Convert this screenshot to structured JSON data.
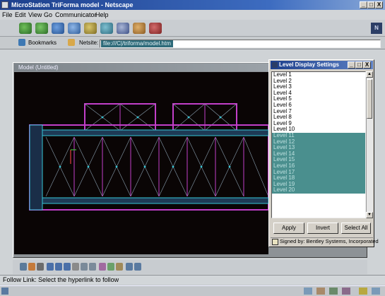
{
  "window": {
    "title": "MicroStation TriForma model - Netscape",
    "controls": [
      "_",
      "□",
      "X"
    ]
  },
  "menu": [
    "File",
    "Edit",
    "View",
    "Go",
    "Communicator",
    "Help"
  ],
  "toolbar_icons": [
    "back-icon",
    "forward-icon",
    "reload-icon",
    "home-icon",
    "search-icon",
    "netscape-icon",
    "print-icon",
    "security-icon",
    "stop-icon"
  ],
  "location": {
    "bookmarks_label": "Bookmarks",
    "netsite_label": "Netsite:",
    "url": "file:///C|/triforma/model.htm"
  },
  "model_window": {
    "title": "Model (Untitled)"
  },
  "level_dialog": {
    "title": "Level Display Settings",
    "levels": [
      {
        "label": "Level 1",
        "selected": false
      },
      {
        "label": "Level 2",
        "selected": false
      },
      {
        "label": "Level 3",
        "selected": false
      },
      {
        "label": "Level 4",
        "selected": false
      },
      {
        "label": "Level 5",
        "selected": false
      },
      {
        "label": "Level 6",
        "selected": false
      },
      {
        "label": "Level 7",
        "selected": false
      },
      {
        "label": "Level 8",
        "selected": false
      },
      {
        "label": "Level 9",
        "selected": false
      },
      {
        "label": "Level 10",
        "selected": false
      },
      {
        "label": "Level 11",
        "selected": true
      },
      {
        "label": "Level 12",
        "selected": true
      },
      {
        "label": "Level 13",
        "selected": true
      },
      {
        "label": "Level 14",
        "selected": true
      },
      {
        "label": "Level 15",
        "selected": true
      },
      {
        "label": "Level 16",
        "selected": true
      },
      {
        "label": "Level 17",
        "selected": true
      },
      {
        "label": "Level 18",
        "selected": true
      },
      {
        "label": "Level 19",
        "selected": true
      },
      {
        "label": "Level 20",
        "selected": true
      }
    ],
    "apply_label": "Apply",
    "invert_label": "Invert",
    "select_all_label": "Select All",
    "signed_text": "Signed by: Bentley Systems, Incorporated"
  },
  "status": {
    "text": "Follow Link: Select the hyperlink to follow"
  },
  "colors": {
    "title_bar": "#1d3f8c",
    "selection": "#4a8f8e",
    "canvas_bg": "#0a0505",
    "wall_magenta": "#c23fc9",
    "wall_cyan": "#37c6d6"
  }
}
